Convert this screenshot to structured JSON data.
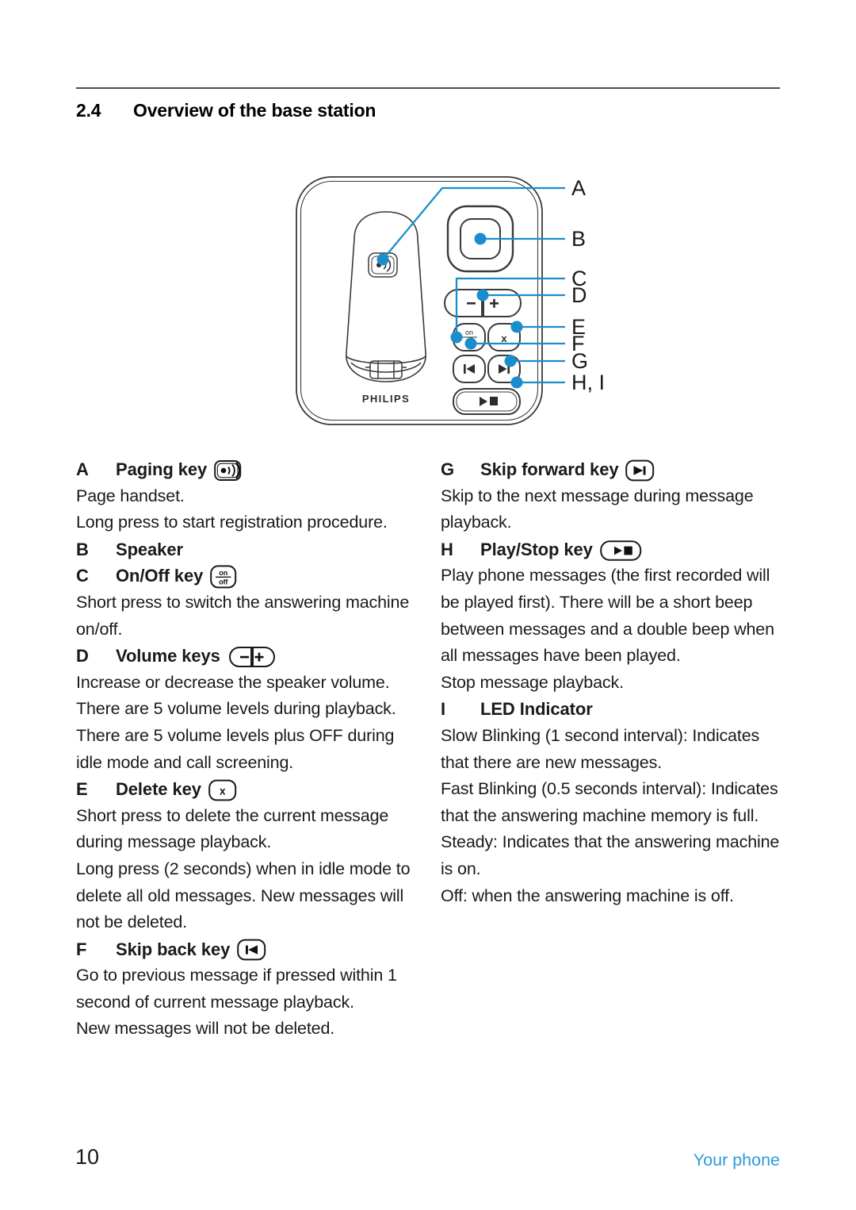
{
  "header": {
    "section_number": "2.4",
    "section_title": "Overview of the base station"
  },
  "figure": {
    "brand": "PHILIPS",
    "callout_labels": [
      "A",
      "B",
      "C",
      "D",
      "E",
      "F",
      "G",
      "H, I"
    ],
    "accent_color": "#1b8dcd",
    "outline_color": "#3a3a3a",
    "button_glyphs": {
      "volume_minus": "−",
      "volume_plus": "+",
      "onoff_top": "on",
      "onoff_bottom": "off",
      "delete": "x"
    }
  },
  "left_column": [
    {
      "type": "heading",
      "letter": "A",
      "label": "Paging key",
      "icon": "paging-key-icon"
    },
    {
      "type": "paragraph",
      "text": "Page handset."
    },
    {
      "type": "paragraph",
      "text": "Long press to start registration procedure."
    },
    {
      "type": "heading",
      "letter": "B",
      "label": "Speaker",
      "icon": null
    },
    {
      "type": "heading",
      "letter": "C",
      "label": "On/Off key",
      "icon": "onoff-key-icon"
    },
    {
      "type": "paragraph",
      "text": "Short press to switch the answering machine on/off."
    },
    {
      "type": "heading",
      "letter": "D",
      "label": "Volume keys",
      "icon": "volume-keys-icon"
    },
    {
      "type": "paragraph",
      "text": "Increase or decrease the speaker volume. There are 5 volume levels during playback. There are 5 volume levels plus OFF during idle mode and call screening."
    },
    {
      "type": "heading",
      "letter": "E",
      "label": "Delete key",
      "icon": "delete-key-icon"
    },
    {
      "type": "paragraph",
      "text": "Short press to delete the current message during message playback."
    },
    {
      "type": "paragraph",
      "text": "Long press (2 seconds) when in idle mode to delete all old messages. New messages will not be deleted."
    },
    {
      "type": "heading",
      "letter": "F",
      "label": "Skip back key",
      "icon": "skip-back-key-icon"
    },
    {
      "type": "paragraph",
      "text": "Go to previous message if pressed within 1 second of current message playback."
    },
    {
      "type": "paragraph",
      "text": "New messages will not be deleted."
    }
  ],
  "right_column": [
    {
      "type": "heading",
      "letter": "G",
      "label": "Skip forward key",
      "icon": "skip-forward-key-icon"
    },
    {
      "type": "paragraph",
      "text": "Skip to the next message during message playback."
    },
    {
      "type": "heading",
      "letter": "H",
      "label": "Play/Stop key",
      "icon": "play-stop-key-icon"
    },
    {
      "type": "paragraph",
      "text": "Play phone messages (the first recorded will be played first). There will be a short beep between messages and a double beep when all messages have been played."
    },
    {
      "type": "paragraph",
      "text": "Stop message playback."
    },
    {
      "type": "heading",
      "letter": "I",
      "label": "LED Indicator",
      "icon": null
    },
    {
      "type": "paragraph",
      "text": "Slow Blinking (1 second interval): Indicates that there are new messages."
    },
    {
      "type": "paragraph",
      "text": "Fast Blinking (0.5 seconds interval): Indicates that the answering machine memory is full."
    },
    {
      "type": "paragraph",
      "text": "Steady: Indicates that the answering machine is on."
    },
    {
      "type": "paragraph",
      "text": "Off: when the answering machine is off."
    }
  ],
  "footer": {
    "page_number": "10",
    "chapter_label": "Your phone",
    "chapter_color": "#2f9bdb"
  }
}
